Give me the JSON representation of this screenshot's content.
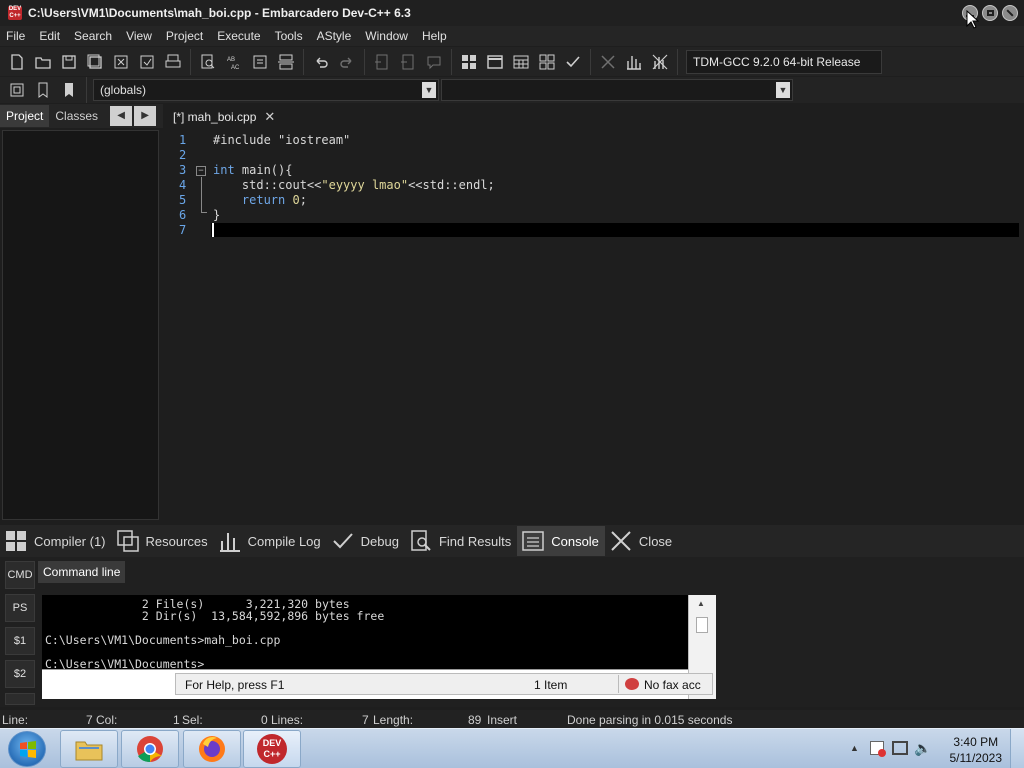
{
  "window": {
    "title": "C:\\Users\\VM1\\Documents\\mah_boi.cpp - Embarcadero Dev-C++ 6.3",
    "app_icon_text": "DEV C++"
  },
  "menu": [
    "File",
    "Edit",
    "Search",
    "View",
    "Project",
    "Execute",
    "Tools",
    "AStyle",
    "Window",
    "Help"
  ],
  "toolbar": {
    "compiler": "TDM-GCC 9.2.0 64-bit Release",
    "scope_combo": "(globals)",
    "function_combo": ""
  },
  "left_panel": {
    "tabs": [
      "Project",
      "Classes"
    ],
    "active_tab": "Project"
  },
  "editor": {
    "tab_label": "[*] mah_boi.cpp",
    "line_numbers": [
      "1",
      "2",
      "3",
      "4",
      "5",
      "6",
      "7"
    ],
    "lines": {
      "l1": "#include \"iostream\"",
      "l3_kw": "int",
      "l3_rest": " main(){",
      "l4_pre": "    std::cout<<",
      "l4_str": "\"eyyyy lmao\"",
      "l4_post": "<<std::endl;",
      "l5_kw": "    return",
      "l5_num": " 0",
      "l5_end": ";",
      "l6": "}"
    }
  },
  "bottom_tabs": [
    "Compiler (1)",
    "Resources",
    "Compile Log",
    "Debug",
    "Find Results",
    "Console",
    "Close"
  ],
  "console_panel": {
    "side_buttons": [
      "CMD",
      "PS",
      "$1",
      "$2"
    ],
    "tab": "Command line",
    "output": [
      "              2 File(s)      3,221,320 bytes",
      "              2 Dir(s)  13,584,592,896 bytes free",
      "",
      "C:\\Users\\VM1\\Documents>mah_boi.cpp",
      "",
      "C:\\Users\\VM1\\Documents>"
    ],
    "help_bar": {
      "help": "For Help, press F1",
      "items": "1 Item",
      "fax": "No fax acc"
    }
  },
  "statusbar": {
    "line_label": "Line:",
    "line_value": "7",
    "col_label": "Col:",
    "col_value": "1",
    "sel_label": "Sel:",
    "sel_value": "0",
    "lines_label": "Lines:",
    "lines_value": "7",
    "length_label": "Length:",
    "length_value": "89",
    "mode": "Insert",
    "message": "Done parsing in 0.015 seconds"
  },
  "taskbar": {
    "time": "3:40 PM",
    "date": "5/11/2023",
    "devcpp_label": "DEV C++"
  },
  "colors": {
    "keyword": "#6ea6e6",
    "string": "#e0d89a",
    "line_number": "#6aa6e8",
    "background": "#1e1e1e"
  }
}
